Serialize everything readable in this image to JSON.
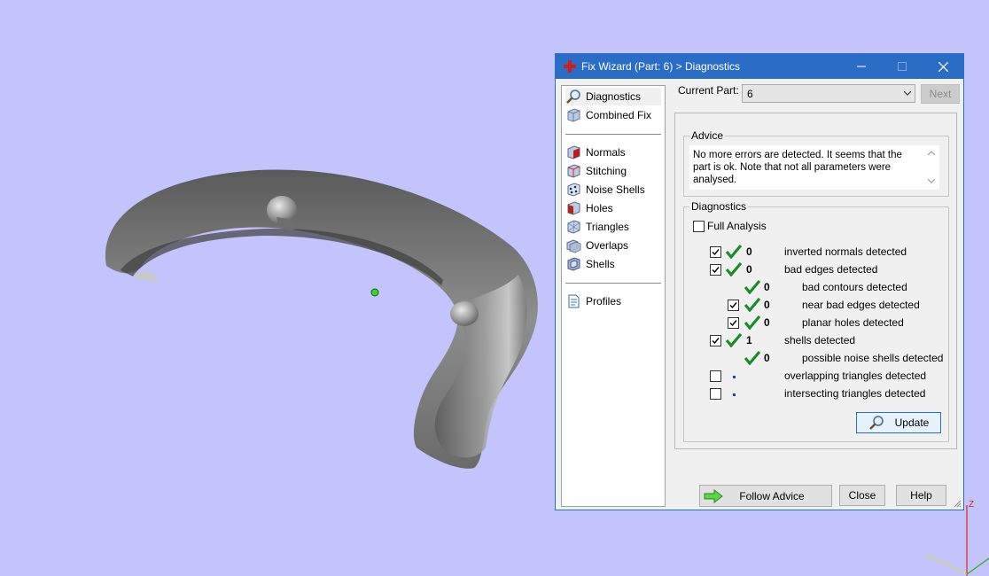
{
  "window": {
    "title": "Fix Wizard (Part: 6) > Diagnostics",
    "app_icon": "red-cross-icon"
  },
  "nav": {
    "items": [
      {
        "label": "Diagnostics",
        "icon": "magnifier-icon",
        "selected": true
      },
      {
        "label": "Combined Fix",
        "icon": "cube-icon"
      },
      {
        "label": "Normals",
        "icon": "normals-cube-icon"
      },
      {
        "label": "Stitching",
        "icon": "stitching-cube-icon"
      },
      {
        "label": "Noise Shells",
        "icon": "noise-shells-icon"
      },
      {
        "label": "Holes",
        "icon": "holes-cube-icon"
      },
      {
        "label": "Triangles",
        "icon": "triangles-icon"
      },
      {
        "label": "Overlaps",
        "icon": "overlaps-icon"
      },
      {
        "label": "Shells",
        "icon": "shells-icon"
      },
      {
        "label": "Profiles",
        "icon": "document-icon"
      }
    ]
  },
  "current_part": {
    "label": "Current Part:",
    "value": "6",
    "next_label": "Next"
  },
  "advice": {
    "title": "Advice",
    "text": "No more errors are detected. It seems that the part is ok. Note that not all parameters were analysed."
  },
  "diagnostics": {
    "title": "Diagnostics",
    "full_analysis_label": "Full Analysis",
    "full_analysis_checked": false,
    "rows": [
      {
        "checkbox": true,
        "checked": true,
        "status": "ok",
        "count": "0",
        "label": "inverted normals detected",
        "indent": 0
      },
      {
        "checkbox": true,
        "checked": true,
        "status": "ok",
        "count": "0",
        "label": "bad edges detected",
        "indent": 0
      },
      {
        "checkbox": false,
        "checked": false,
        "status": "ok",
        "count": "0",
        "label": "bad contours detected",
        "indent": 1
      },
      {
        "checkbox": true,
        "checked": true,
        "status": "ok",
        "count": "0",
        "label": "near bad edges detected",
        "indent": 1
      },
      {
        "checkbox": true,
        "checked": true,
        "status": "ok",
        "count": "0",
        "label": "planar holes detected",
        "indent": 1
      },
      {
        "checkbox": true,
        "checked": true,
        "status": "ok",
        "count": "1",
        "label": "shells detected",
        "indent": 0
      },
      {
        "checkbox": false,
        "checked": false,
        "status": "ok",
        "count": "0",
        "label": "possible noise shells detected",
        "indent": 1
      },
      {
        "checkbox": true,
        "checked": false,
        "status": "dot",
        "count": "",
        "label": "overlapping triangles detected",
        "indent": 0
      },
      {
        "checkbox": true,
        "checked": false,
        "status": "dot",
        "count": "",
        "label": "intersecting triangles detected",
        "indent": 0
      }
    ],
    "update_label": "Update"
  },
  "footer": {
    "follow_advice_label": "Follow Advice",
    "close_label": "Close",
    "help_label": "Help"
  },
  "viewport": {
    "background": "#c4c4fc",
    "axis_label": "Z"
  },
  "colors": {
    "titlebar": "#2b6cc4",
    "check_green": "#1f8a2b",
    "dot_blue": "#1a3fd6"
  }
}
